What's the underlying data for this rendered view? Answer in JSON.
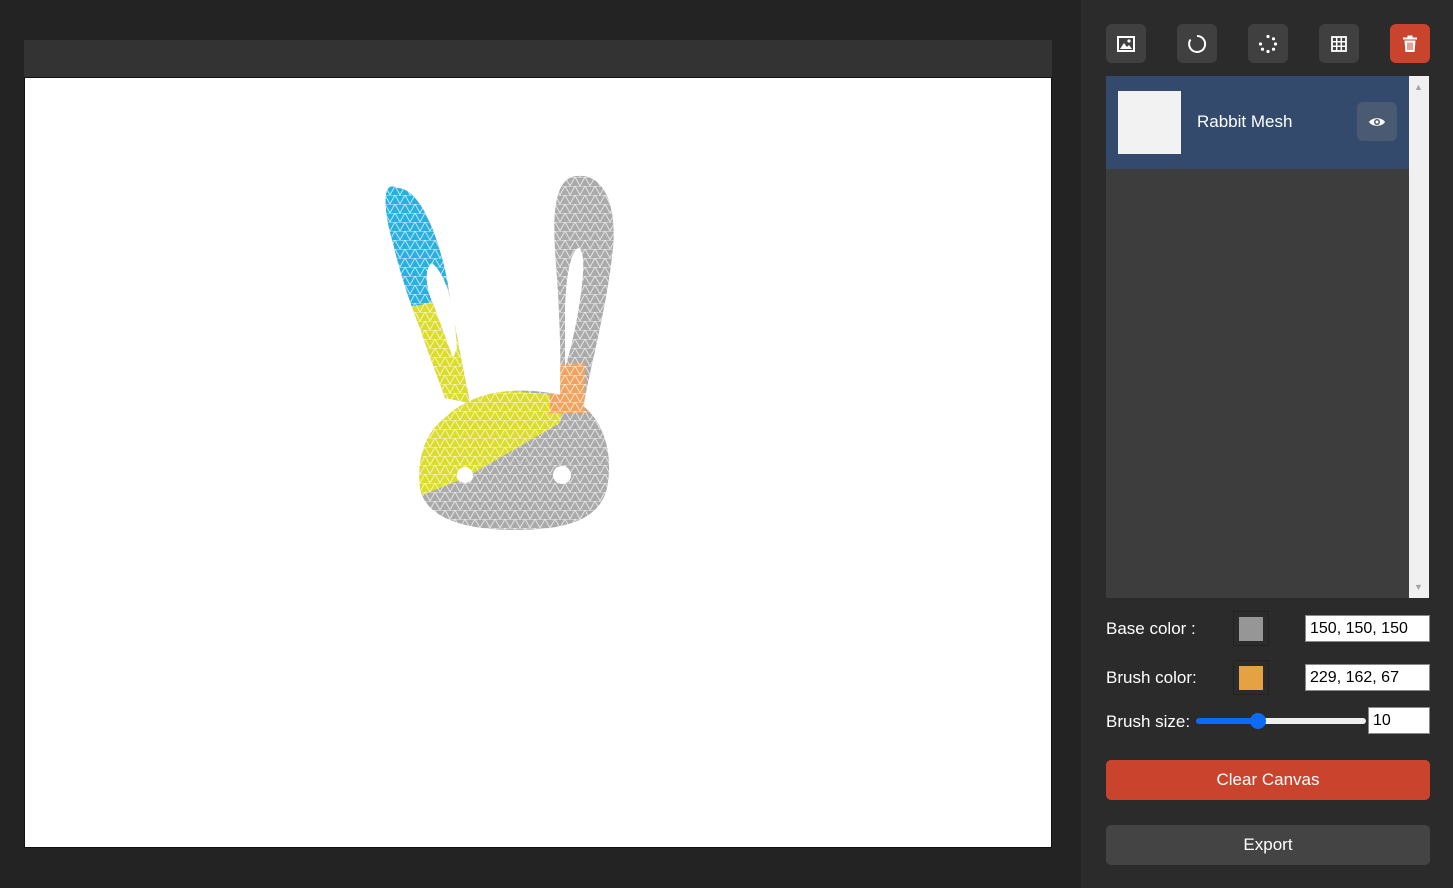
{
  "toolbar": {
    "icons": [
      "image-icon",
      "reload-icon",
      "loading-dots-icon",
      "grid-icon",
      "trash-icon"
    ],
    "danger_color": "#c9432d"
  },
  "layers": {
    "items": [
      {
        "name": "Rabbit Mesh",
        "visible": true
      }
    ],
    "selected_color": "#334a6c"
  },
  "controls": {
    "base_color_label": "Base color :",
    "base_color_value": "150, 150, 150",
    "base_color_hex": "#969696",
    "brush_color_label": "Brush color:",
    "brush_color_value": "229, 162, 67",
    "brush_color_hex": "#e5a243",
    "brush_size_label": "Brush size:",
    "brush_size_value": "10",
    "brush_size_slider_fraction": 0.35
  },
  "buttons": {
    "clear_label": "Clear Canvas",
    "export_label": "Export"
  },
  "canvas": {
    "mesh_colors": {
      "base": "#aaaaaa",
      "blue": "#2ab0e0",
      "yellow": "#dcdc2c",
      "orange": "#f0a35e"
    }
  }
}
